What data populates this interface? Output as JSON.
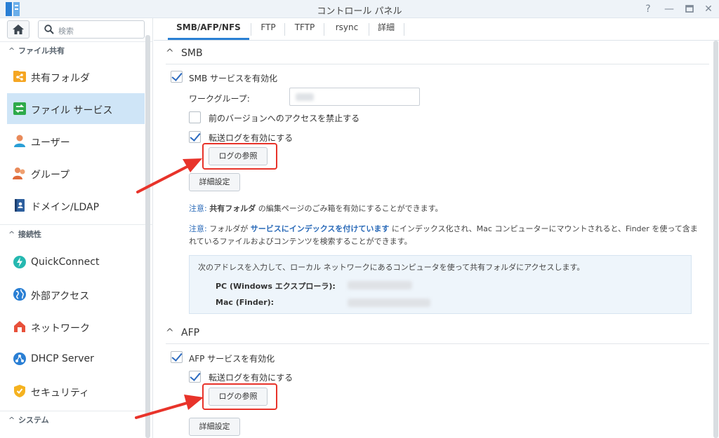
{
  "window": {
    "title": "コントロール パネル",
    "help_icon": "help-icon",
    "minimize_icon": "minimize-icon",
    "maximize_icon": "maximize-icon",
    "close_icon": "close-icon"
  },
  "sidebar": {
    "search_placeholder": "検索",
    "groups": [
      {
        "label": "ファイル共有"
      },
      {
        "label": "接続性"
      },
      {
        "label": "システム"
      }
    ],
    "items": [
      {
        "label": "共有フォルダ",
        "icon": "shared-folder-icon"
      },
      {
        "label": "ファイル サービス",
        "icon": "file-services-icon",
        "active": true
      },
      {
        "label": "ユーザー",
        "icon": "user-icon"
      },
      {
        "label": "グループ",
        "icon": "group-icon"
      },
      {
        "label": "ドメイン/LDAP",
        "icon": "domain-ldap-icon"
      },
      {
        "label": "QuickConnect",
        "icon": "quickconnect-icon"
      },
      {
        "label": "外部アクセス",
        "icon": "external-access-icon"
      },
      {
        "label": "ネットワーク",
        "icon": "network-icon"
      },
      {
        "label": "DHCP Server",
        "icon": "dhcp-server-icon"
      },
      {
        "label": "セキュリティ",
        "icon": "security-icon"
      }
    ]
  },
  "tabs": [
    {
      "label": "SMB/AFP/NFS",
      "active": true
    },
    {
      "label": "FTP"
    },
    {
      "label": "TFTP"
    },
    {
      "label": "rsync"
    },
    {
      "label": "詳細"
    }
  ],
  "smb": {
    "title": "SMB",
    "enable_label": "SMB サービスを有効化",
    "enable_checked": true,
    "workgroup_label": "ワークグループ:",
    "disable_prev_label": "前のバージョンへのアクセスを禁止する",
    "disable_prev_checked": false,
    "transfer_log_label": "転送ログを有効にする",
    "transfer_log_checked": true,
    "view_log_button": "ログの参照",
    "advanced_button": "詳細設定",
    "note1": {
      "prefix": "注意:",
      "bold": "共有フォルダ",
      "rest": " の編集ページのごみ箱を有効にすることができます。"
    },
    "note2": {
      "prefix": "注意:",
      "text1": " フォルダが ",
      "bold": "サービスにインデックスを付けています",
      "text2": " にインデックス化され、Mac コンピューターにマウントされると、Finder を使って含ま",
      "line2": "れているファイルおよびコンテンツを検索することができます。"
    },
    "access_intro": "次のアドレスを入力して、ローカル ネットワークにあるコンピュータを使って共有フォルダにアクセスします。",
    "pc_label": "PC (Windows エクスプローラ):",
    "mac_label": "Mac (Finder):"
  },
  "afp": {
    "title": "AFP",
    "enable_label": "AFP サービスを有効化",
    "enable_checked": true,
    "transfer_log_label": "転送ログを有効にする",
    "transfer_log_checked": true,
    "view_log_button": "ログの参照",
    "advanced_button": "詳細設定"
  },
  "colors": {
    "accent": "#2a80d4",
    "highlight": "#e8332a",
    "active_nav": "#cfe5f7"
  }
}
